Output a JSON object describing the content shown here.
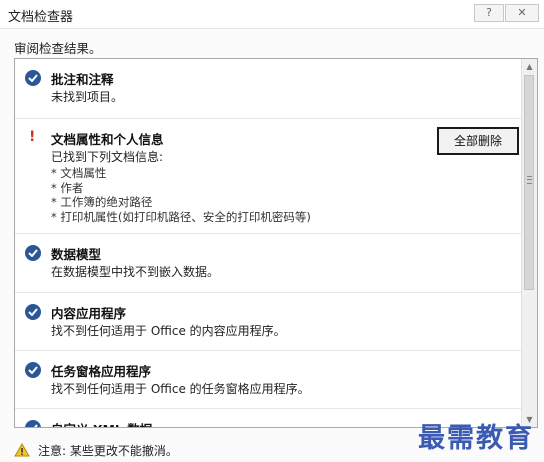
{
  "window": {
    "title": "文档检查器",
    "help_label": "?",
    "close_label": "✕"
  },
  "subtitle": "审阅检查结果。",
  "items": [
    {
      "status": "ok",
      "title": "批注和注释",
      "desc": "未找到项目。"
    },
    {
      "status": "warning",
      "title": "文档属性和个人信息",
      "desc": "已找到下列文档信息:",
      "bullets": [
        "* 文档属性",
        "* 作者",
        "* 工作簿的绝对路径",
        "* 打印机属性(如打印机路径、安全的打印机密码等)"
      ],
      "button": "全部删除"
    },
    {
      "status": "ok",
      "title": "数据模型",
      "desc": "在数据模型中找不到嵌入数据。"
    },
    {
      "status": "ok",
      "title": "内容应用程序",
      "desc": "找不到任何适用于 Office 的内容应用程序。"
    },
    {
      "status": "ok",
      "title": "任务窗格应用程序",
      "desc": "找不到任何适用于 Office 的任务窗格应用程序。"
    },
    {
      "status": "ok",
      "title": "自定义 XML 数据",
      "desc": ""
    }
  ],
  "footer": {
    "text": "注意: 某些更改不能撤消。"
  },
  "watermark": "最需教育",
  "colors": {
    "accent": "#2b5797",
    "warning": "#c0392b",
    "watermark": "#3a5ab3"
  }
}
